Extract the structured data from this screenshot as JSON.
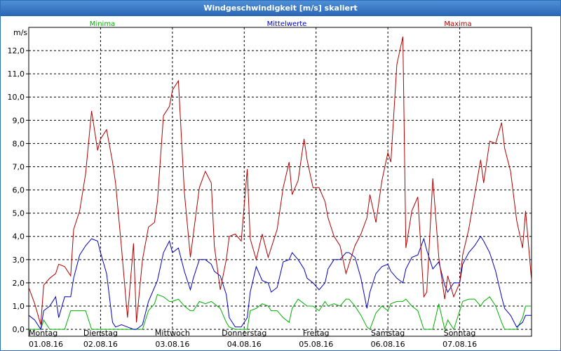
{
  "window": {
    "title": "Windgeschwindigkeit [m/s] skaliert"
  },
  "chart_data": {
    "type": "line",
    "title": "Windgeschwindigkeit [m/s] skaliert",
    "ylabel": "m/s",
    "ylim": [
      -0.3,
      13.0
    ],
    "yticks": [
      "0,0",
      "1,0",
      "2,0",
      "3,0",
      "4,0",
      "5,0",
      "6,0",
      "7,0",
      "8,0",
      "9,0",
      "10,0",
      "11,0",
      "12,0"
    ],
    "xlim": [
      0,
      168
    ],
    "xticks": [
      {
        "day": "Montag",
        "date": "01.08.16"
      },
      {
        "day": "Dienstag",
        "date": "02.08.16"
      },
      {
        "day": "Mittwoch",
        "date": "03.08.16"
      },
      {
        "day": "Donnerstag",
        "date": "04.08.16"
      },
      {
        "day": "Freitag",
        "date": "05.08.16"
      },
      {
        "day": "Samstag",
        "date": "06.08.16"
      },
      {
        "day": "Sonntag",
        "date": "07.08.16"
      }
    ],
    "x_unit": "hours since 01.08.16 00:00",
    "grid": true,
    "legend": "top",
    "series": [
      {
        "name": "Minima",
        "color": "#00b000",
        "x": [
          0,
          2,
          4,
          5,
          7,
          9,
          10,
          12,
          14,
          15,
          17,
          19,
          21,
          23,
          24,
          26,
          28,
          29,
          31,
          33,
          35,
          36,
          38,
          40,
          42,
          43,
          45,
          47,
          48,
          50,
          52,
          54,
          55,
          57,
          59,
          61,
          62,
          64,
          66,
          67,
          69,
          71,
          73,
          74,
          76,
          78,
          80,
          81,
          83,
          85,
          87,
          88,
          90,
          92,
          93,
          95,
          97,
          99,
          100,
          102,
          104,
          106,
          107,
          109,
          111,
          113,
          114,
          116,
          118,
          120,
          121,
          123,
          125,
          126,
          128,
          130,
          132,
          133,
          135,
          137,
          139,
          140,
          142,
          144,
          145,
          147,
          149,
          151,
          152,
          154,
          156,
          158,
          159,
          161,
          163,
          165,
          166,
          168
        ],
        "y": [
          0.0,
          0.0,
          0.0,
          0.4,
          0.0,
          0.0,
          0.0,
          0.0,
          0.8,
          0.8,
          0.8,
          0.8,
          0.0,
          0.0,
          0.0,
          0.0,
          0.0,
          0.0,
          0.0,
          0.0,
          0.0,
          0.0,
          0.0,
          0.8,
          1.1,
          1.5,
          1.4,
          1.2,
          1.2,
          1.3,
          1.0,
          0.8,
          0.8,
          1.2,
          1.1,
          1.2,
          1.1,
          0.9,
          0.3,
          0.1,
          0.0,
          0.0,
          0.0,
          0.8,
          0.9,
          1.1,
          1.0,
          0.8,
          0.8,
          0.5,
          0.3,
          0.9,
          1.3,
          1.1,
          1.0,
          1.0,
          0.8,
          1.2,
          1.0,
          1.1,
          1.0,
          1.3,
          1.3,
          1.0,
          0.6,
          0.1,
          0.0,
          0.7,
          1.0,
          0.8,
          1.1,
          1.2,
          1.2,
          1.3,
          1.0,
          0.8,
          0.0,
          0.0,
          0.0,
          1.1,
          0.0,
          0.4,
          0.0,
          0.8,
          1.2,
          1.3,
          1.3,
          1.0,
          1.2,
          1.4,
          1.0,
          0.3,
          0.0,
          0.0,
          0.0,
          0.5,
          1.0,
          1.0
        ]
      },
      {
        "name": "Mittelwerte",
        "color": "#0000c0",
        "x": [
          0,
          2,
          4,
          5,
          7,
          9,
          10,
          12,
          14,
          15,
          17,
          19,
          21,
          23,
          24,
          26,
          28,
          29,
          31,
          33,
          35,
          36,
          38,
          40,
          42,
          43,
          45,
          47,
          48,
          50,
          52,
          54,
          55,
          57,
          59,
          61,
          62,
          64,
          66,
          67,
          69,
          71,
          73,
          74,
          76,
          78,
          80,
          81,
          83,
          85,
          87,
          88,
          90,
          92,
          93,
          95,
          97,
          99,
          100,
          102,
          104,
          106,
          107,
          109,
          111,
          113,
          114,
          116,
          118,
          120,
          121,
          123,
          125,
          126,
          128,
          130,
          132,
          133,
          135,
          137,
          139,
          140,
          142,
          144,
          145,
          147,
          149,
          151,
          152,
          154,
          156,
          158,
          159,
          161,
          163,
          165,
          166,
          168
        ],
        "y": [
          0.6,
          0.4,
          0.0,
          0.8,
          1.0,
          1.4,
          0.5,
          1.4,
          1.4,
          2.2,
          3.2,
          3.6,
          3.9,
          3.8,
          3.3,
          2.4,
          0.3,
          0.1,
          0.2,
          0.1,
          0.0,
          0.0,
          0.2,
          1.2,
          1.8,
          2.1,
          3.3,
          3.8,
          3.3,
          3.5,
          2.5,
          1.7,
          2.2,
          3.0,
          3.0,
          2.8,
          2.5,
          2.3,
          1.5,
          0.5,
          0.1,
          0.1,
          0.5,
          1.6,
          2.7,
          2.1,
          2.0,
          1.6,
          1.8,
          2.9,
          3.0,
          3.3,
          3.0,
          2.6,
          2.2,
          2.0,
          1.7,
          2.0,
          2.6,
          3.0,
          3.0,
          3.3,
          3.3,
          3.1,
          2.2,
          0.9,
          1.6,
          2.4,
          2.7,
          2.8,
          2.5,
          2.2,
          2.0,
          2.6,
          3.1,
          3.2,
          3.9,
          3.4,
          2.6,
          2.9,
          1.9,
          1.6,
          2.0,
          2.0,
          2.8,
          3.3,
          3.6,
          4.0,
          3.8,
          3.3,
          2.5,
          1.4,
          0.9,
          0.6,
          0.1,
          0.3,
          0.6,
          0.6
        ]
      },
      {
        "name": "Maxima",
        "color": "#b00000",
        "x": [
          0,
          2,
          4,
          5,
          7,
          9,
          10,
          12,
          14,
          15,
          17,
          19,
          21,
          23,
          24,
          26,
          28,
          29,
          31,
          33,
          35,
          36,
          38,
          40,
          42,
          43,
          45,
          47,
          48,
          50,
          52,
          54,
          55,
          57,
          59,
          61,
          62,
          64,
          66,
          67,
          69,
          71,
          73,
          74,
          76,
          78,
          80,
          81,
          83,
          85,
          87,
          88,
          90,
          92,
          93,
          95,
          97,
          99,
          100,
          102,
          104,
          106,
          107,
          109,
          111,
          113,
          114,
          116,
          118,
          120,
          121,
          123,
          125,
          126,
          128,
          130,
          132,
          133,
          135,
          137,
          139,
          140,
          142,
          144,
          145,
          147,
          149,
          151,
          152,
          154,
          156,
          158,
          159,
          161,
          163,
          165,
          166,
          168
        ],
        "y": [
          1.8,
          1.1,
          0.2,
          1.9,
          2.2,
          2.4,
          2.8,
          2.7,
          2.3,
          4.3,
          5.1,
          6.7,
          9.4,
          7.7,
          8.2,
          8.6,
          7.2,
          6.3,
          3.5,
          0.5,
          3.7,
          0.3,
          3.0,
          4.4,
          4.6,
          5.5,
          9.2,
          9.6,
          10.3,
          10.7,
          5.9,
          3.1,
          4.1,
          6.1,
          6.8,
          6.3,
          3.6,
          1.7,
          3.0,
          4.0,
          4.1,
          3.8,
          6.9,
          3.9,
          3.0,
          4.1,
          3.1,
          3.5,
          4.3,
          6.1,
          7.2,
          5.8,
          6.4,
          8.2,
          7.3,
          6.1,
          6.1,
          5.5,
          4.8,
          4.0,
          3.6,
          2.4,
          2.8,
          3.6,
          4.1,
          4.8,
          5.8,
          4.6,
          6.4,
          7.6,
          7.2,
          11.4,
          12.6,
          3.5,
          5.1,
          5.7,
          1.4,
          1.6,
          6.5,
          3.1,
          1.3,
          2.3,
          1.4,
          2.0,
          3.2,
          4.3,
          5.8,
          7.3,
          6.3,
          8.1,
          8.0,
          8.9,
          7.8,
          6.8,
          4.7,
          3.5,
          5.1,
          2.1
        ]
      }
    ]
  }
}
